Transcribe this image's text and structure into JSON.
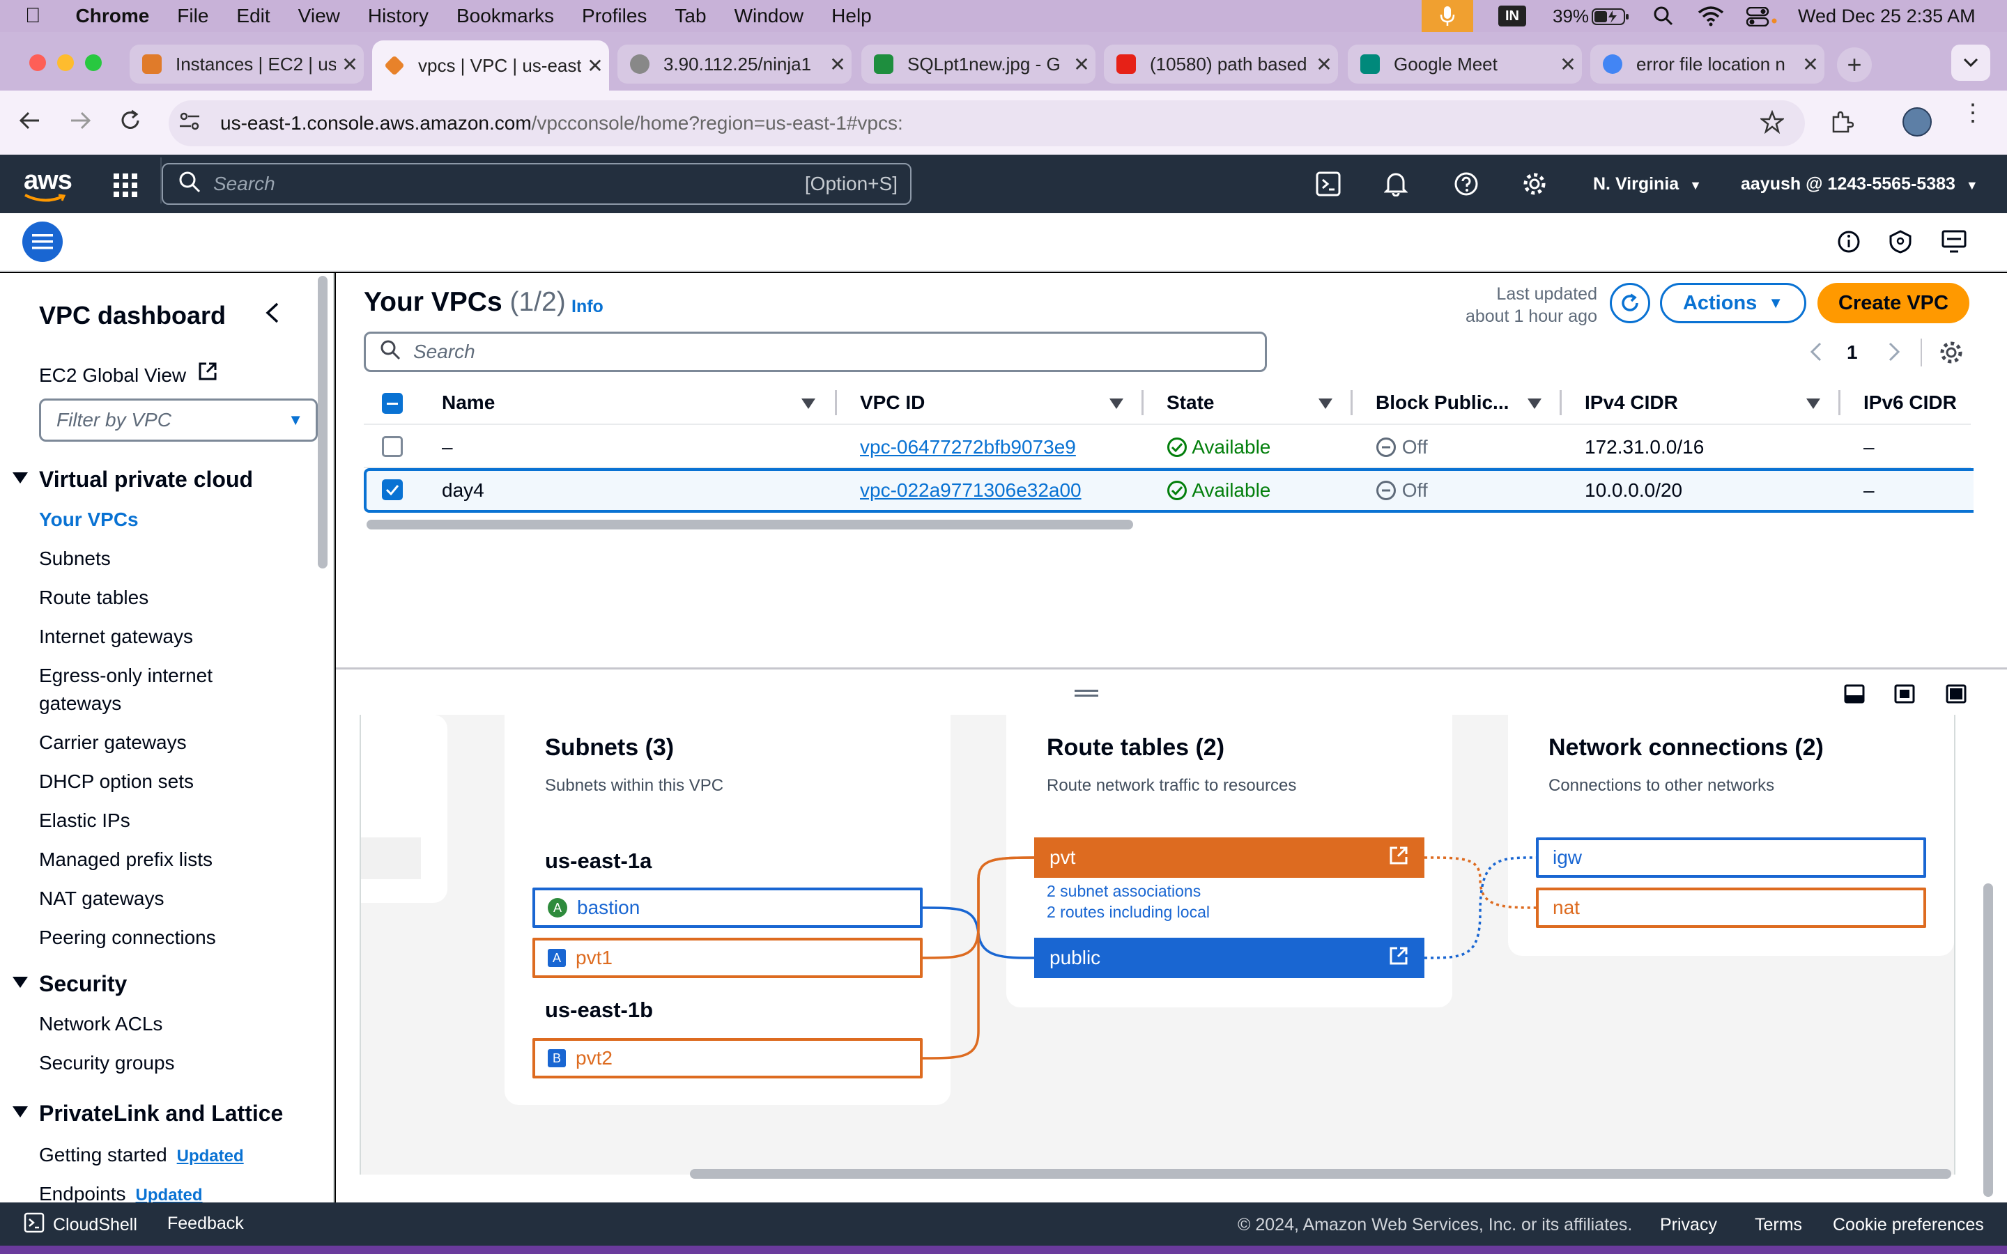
{
  "menubar": {
    "items": [
      "Chrome",
      "File",
      "Edit",
      "View",
      "History",
      "Bookmarks",
      "Profiles",
      "Tab",
      "Window",
      "Help"
    ],
    "input_source": "IN",
    "battery": "39%",
    "datetime": "Wed Dec 25  2:35 AM"
  },
  "tabs": [
    {
      "title": "Instances | EC2 | us-",
      "color": "#e07b2a"
    },
    {
      "title": "vpcs | VPC | us-east",
      "color": "#e8822a"
    },
    {
      "title": "3.90.112.25/ninja1",
      "color": "#777"
    },
    {
      "title": "SQLpt1new.jpg - G",
      "color": "#1e8e3e"
    },
    {
      "title": "(10580) path based",
      "color": "#e62117"
    },
    {
      "title": "Google Meet",
      "color": "#00897b"
    },
    {
      "title": "error file location n",
      "color": "#4285f4"
    }
  ],
  "url": {
    "host": "us-east-1.console.aws.amazon.com",
    "path": "/vpcconsole/home?region=us-east-1#vpcs:"
  },
  "aws": {
    "logo": "aws",
    "search_placeholder": "Search",
    "search_shortcut": "[Option+S]",
    "region": "N. Virginia",
    "account": "aayush @ 1243-5565-5383"
  },
  "sidebar": {
    "title": "VPC dashboard",
    "ec2_global": "EC2 Global View",
    "filter_placeholder": "Filter by VPC",
    "sections": [
      {
        "label": "Virtual private cloud",
        "items": [
          "Your VPCs",
          "Subnets",
          "Route tables",
          "Internet gateways",
          "Egress-only internet",
          "gateways",
          "Carrier gateways",
          "DHCP option sets",
          "Elastic IPs",
          "Managed prefix lists",
          "NAT gateways",
          "Peering connections"
        ]
      },
      {
        "label": "Security",
        "items": [
          "Network ACLs",
          "Security groups"
        ]
      },
      {
        "label": "PrivateLink and Lattice",
        "items": [
          "Getting started",
          "Endpoints"
        ]
      }
    ],
    "badge": "Updated"
  },
  "vpcs": {
    "title": "Your VPCs",
    "count": "(1/2)",
    "info": "Info",
    "last_updated_1": "Last updated",
    "last_updated_2": "about 1 hour ago",
    "actions_label": "Actions",
    "create_label": "Create VPC",
    "search_placeholder": "Search",
    "page": "1",
    "columns": [
      "Name",
      "VPC ID",
      "State",
      "Block Public...",
      "IPv4 CIDR",
      "IPv6 CIDR"
    ],
    "rows": [
      {
        "name": "–",
        "id": "vpc-06477272bfb9073e9",
        "state": "Available",
        "block": "Off",
        "ipv4": "172.31.0.0/16",
        "ipv6": "–",
        "selected": false
      },
      {
        "name": "day4",
        "id": "vpc-022a9771306e32a00",
        "state": "Available",
        "block": "Off",
        "ipv4": "10.0.0.0/20",
        "ipv6": "–",
        "selected": true
      }
    ]
  },
  "resource_map": {
    "subnets": {
      "title": "Subnets (3)",
      "desc": "Subnets within this VPC",
      "az1": "us-east-1a",
      "az2": "us-east-1b",
      "items": [
        {
          "name": "bastion",
          "letter": "A"
        },
        {
          "name": "pvt1",
          "letter": "A"
        },
        {
          "name": "pvt2",
          "letter": "B"
        }
      ]
    },
    "route_tables": {
      "title": "Route tables (2)",
      "desc": "Route network traffic to resources",
      "items": [
        {
          "name": "pvt",
          "note1": "2 subnet associations",
          "note2": "2 routes including local"
        },
        {
          "name": "public"
        }
      ]
    },
    "network": {
      "title": "Network connections (2)",
      "desc": "Connections to other networks",
      "items": [
        "igw",
        "nat"
      ]
    },
    "colors": {
      "orange": "#dd6b20",
      "blue": "#1966d2"
    }
  },
  "footer": {
    "cloudshell": "CloudShell",
    "feedback": "Feedback",
    "copyright": "© 2024, Amazon Web Services, Inc. or its affiliates.",
    "privacy": "Privacy",
    "terms": "Terms",
    "cookies": "Cookie preferences"
  }
}
